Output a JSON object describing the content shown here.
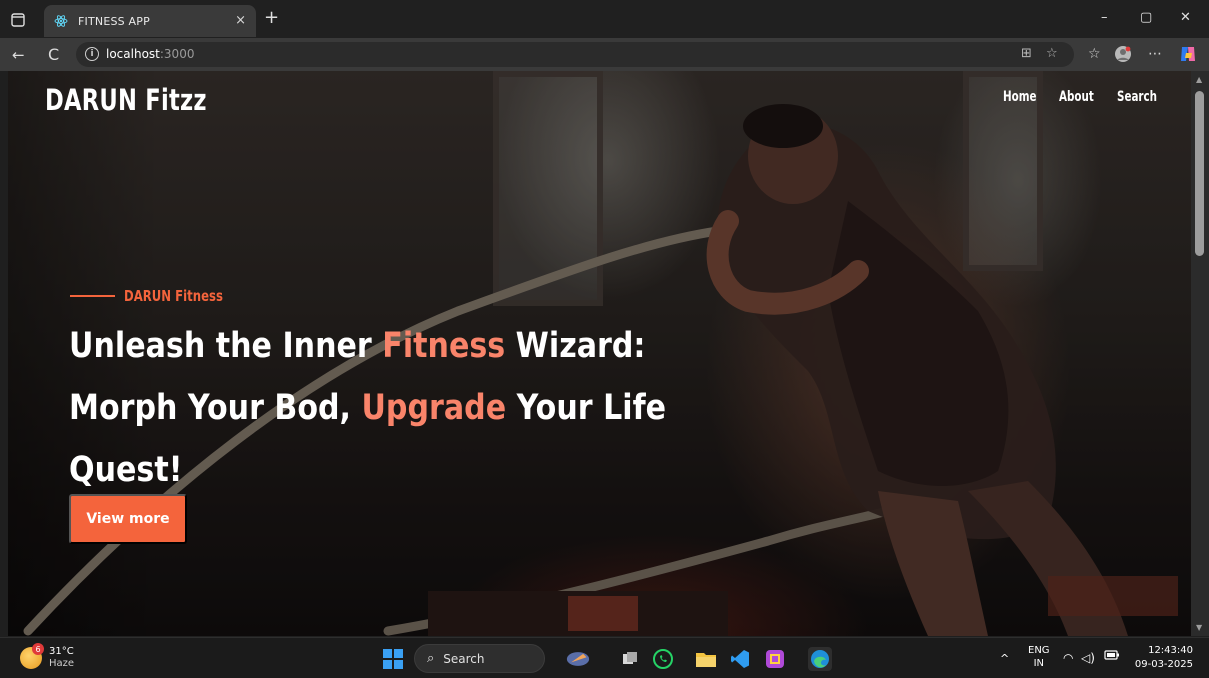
{
  "browser": {
    "tab_title": "FITNESS APP",
    "tab_close": "×",
    "new_tab": "+",
    "window_controls": {
      "minimize": "–",
      "restore": "▢",
      "close": "✕"
    },
    "url_host": "localhost",
    "url_port": ":3000",
    "back": "←",
    "refresh": "C"
  },
  "site": {
    "brand": "DARUN Fitzz",
    "nav": [
      "Home",
      "About",
      "Search"
    ],
    "eyebrow": "DARUN Fitness",
    "headline": {
      "l1_a": "Unleash the Inner ",
      "l1_accent": "Fitness",
      "l1_b": " Wizard:",
      "l2_a": "Morph Your Bod, ",
      "l2_accent": "Upgrade",
      "l2_b": " Your Life",
      "l3": "Quest!"
    },
    "cta_label": "View more",
    "colors": {
      "accent": "#f4643c",
      "accent_text": "#f9846a"
    }
  },
  "taskbar": {
    "weather_temp": "31°C",
    "weather_cond": "Haze",
    "weather_badge": "6",
    "search_label": "Search",
    "lang_top": "ENG",
    "lang_bottom": "IN",
    "time": "12:43:40",
    "date": "09-03-2025"
  }
}
